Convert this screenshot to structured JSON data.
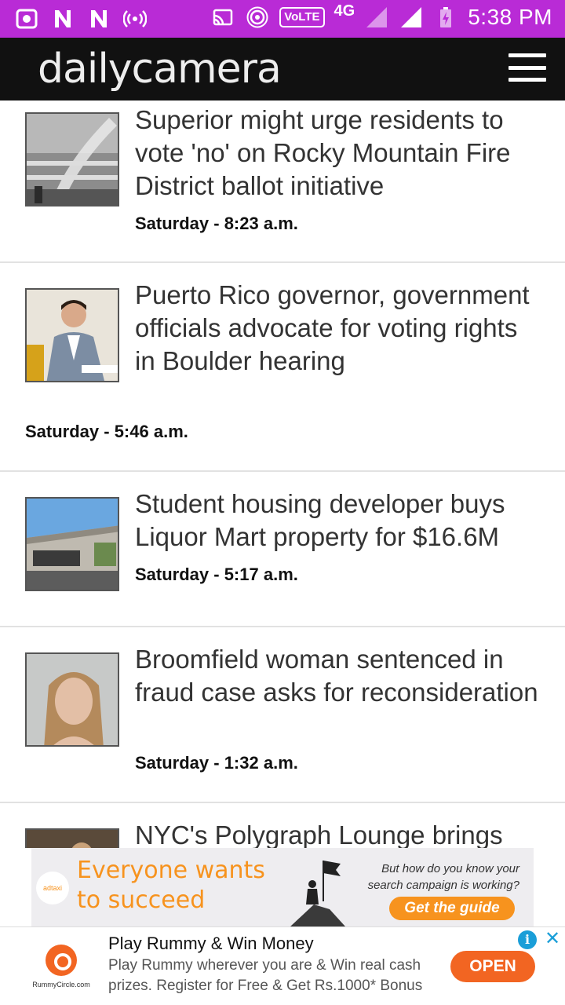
{
  "status_bar": {
    "time": "5:38 PM",
    "network": "4G",
    "volte": "VoLTE",
    "icons": [
      "camera-app-icon",
      "n-notification-icon",
      "n-notification-icon",
      "hotspot-icon",
      "cast-icon",
      "wifi-hotspot-icon",
      "signal-icon",
      "signal-icon",
      "battery-charging-icon"
    ]
  },
  "header": {
    "logo": "dailycamera",
    "menu_icon": "hamburger-menu-icon"
  },
  "articles": [
    {
      "title": "Superior might urge residents to vote 'no' on Rocky Mountain Fire District ballot initiative",
      "time": "Saturday - 8:23 a.m.",
      "image": "fire-hydrant-spray-photo"
    },
    {
      "title": "Puerto Rico governor, government officials advocate for voting rights in Boulder hearing",
      "time": "Saturday - 5:46 a.m.",
      "image": "governor-speaking-photo"
    },
    {
      "title": "Student housing developer buys Liquor Mart property for $16.6M",
      "time": "Saturday - 5:17 a.m.",
      "image": "liquor-mart-building-photo"
    },
    {
      "title": "Broomfield woman sentenced in fraud case asks for reconsideration",
      "time": "Saturday - 1:32 a.m.",
      "image": "mugshot-photo"
    },
    {
      "title": "NYC's Polygraph Lounge brings",
      "time": "",
      "image": "polygraph-lounge-photo"
    }
  ],
  "banner_ad": {
    "logo_text": "adtaxi",
    "headline_line1": "Everyone wants",
    "headline_line2": "to succeed",
    "subtext": "But how do you know your search campaign is working?",
    "cta": "Get the guide"
  },
  "bottom_ad": {
    "brand": "RummyCircle.com",
    "title": "Play Rummy & Win Money",
    "description": "Play Rummy wherever you are & Win real cash prizes. Register for Free & Get Rs.1000* Bonus",
    "button": "OPEN",
    "info_symbol": "i",
    "close_symbol": "✕"
  },
  "colors": {
    "status_bar": "#b92bd6",
    "header": "#111111",
    "ad_orange": "#f26522",
    "adchoices_blue": "#1a9ed8"
  }
}
